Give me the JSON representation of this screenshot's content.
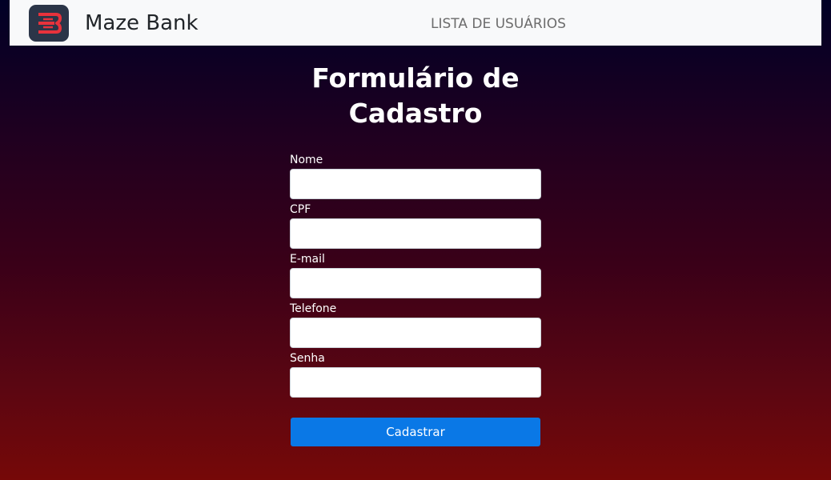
{
  "navbar": {
    "logo_icon": "maze-bank-logo-icon",
    "brand": "Maze Bank",
    "link": "LISTA DE USUÁRIOS"
  },
  "page": {
    "title_line1": "Formulário de",
    "title_line2": "Cadastro"
  },
  "form": {
    "fields": [
      {
        "label": "Nome",
        "value": "",
        "placeholder": ""
      },
      {
        "label": "CPF",
        "value": "",
        "placeholder": ""
      },
      {
        "label": "E-mail",
        "value": "",
        "placeholder": ""
      },
      {
        "label": "Telefone",
        "value": "",
        "placeholder": ""
      },
      {
        "label": "Senha",
        "value": "",
        "placeholder": ""
      }
    ],
    "submit_label": "Cadastrar"
  },
  "colors": {
    "navbar_bg": "#f8f9fa",
    "logo_bg": "#2b3548",
    "logo_accent": "#e8323c",
    "button": "#0a78e6",
    "gradient_top": "#000026",
    "gradient_bottom": "#760808"
  }
}
